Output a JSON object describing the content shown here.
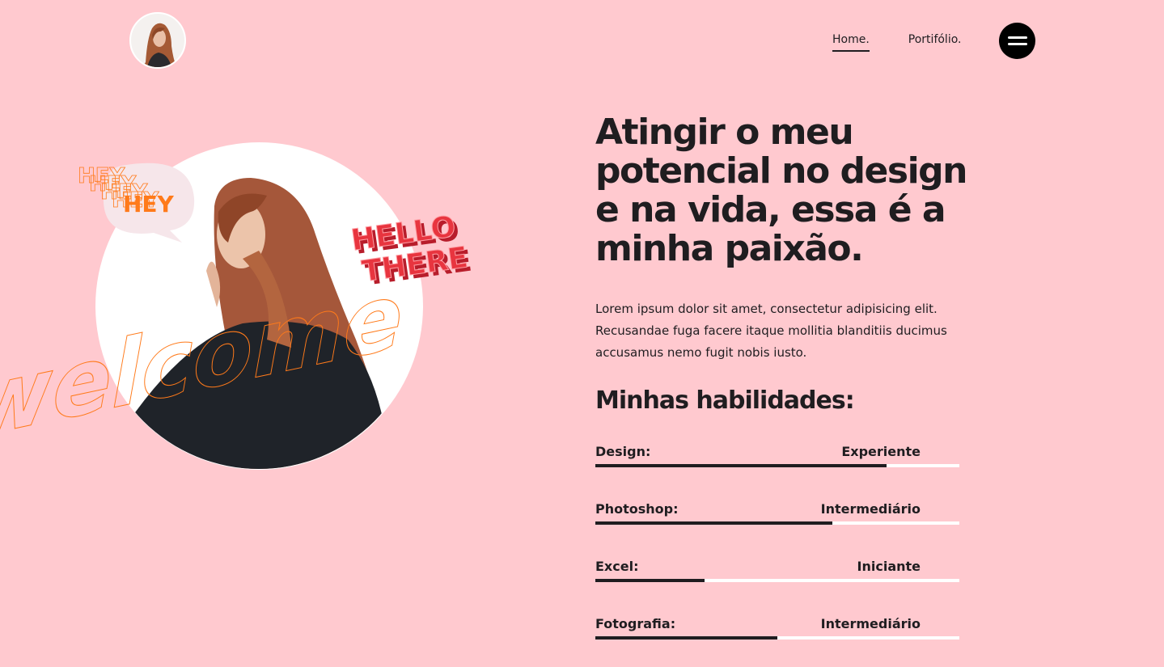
{
  "header": {
    "nav": [
      {
        "label": "Home.",
        "active": true
      },
      {
        "label": "Portifólio.",
        "active": false
      }
    ]
  },
  "hero": {
    "stickers": {
      "hey": "HEY",
      "hello": "HELLO",
      "there": "THERE",
      "welcome": "welcome"
    }
  },
  "content": {
    "headline": "Atingir o meu potencial no design e na vida, essa é a minha paixão.",
    "lead": "Lorem ipsum dolor sit amet, consectetur adipisicing elit. Recusandae fuga facere itaque mollitia blanditiis ducimus accusamus nemo fugit nobis iusto.",
    "skills_title": "Minhas habilidades:",
    "skills": [
      {
        "name": "Design:",
        "level": "Experiente",
        "progress": 0.8
      },
      {
        "name": "Photoshop:",
        "level": "Intermediário",
        "progress": 0.65
      },
      {
        "name": "Excel:",
        "level": "Iniciante",
        "progress": 0.3
      },
      {
        "name": "Fotografia:",
        "level": "Intermediário",
        "progress": 0.5
      }
    ]
  },
  "colors": {
    "background": "#ffc9cf",
    "text": "#1f1d20",
    "accent_orange": "#ff7a1a",
    "accent_red": "#e8353f"
  }
}
